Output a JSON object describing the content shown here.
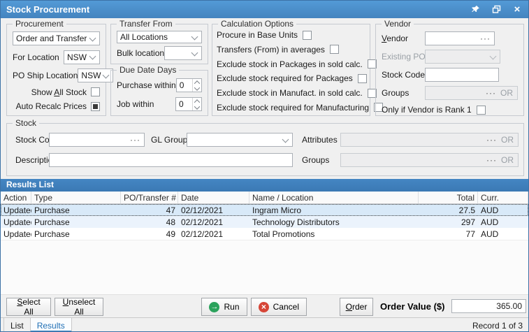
{
  "window": {
    "title": "Stock Procurement"
  },
  "icons": {
    "ellipsis": "···",
    "close": "×",
    "run_arrow": "→",
    "cancel_x": "×"
  },
  "procurement": {
    "legend": "Procurement",
    "mode_value": "Order and Transfer",
    "for_location_label": "For Location",
    "for_location_value": "NSW",
    "po_ship_label": "PO Ship Location",
    "po_ship_value": "NSW",
    "show_all_stock": {
      "pre": "Show ",
      "u": "A",
      "post": "ll Stock"
    },
    "auto_recalc_label": "Auto Recalc Prices"
  },
  "transfer_from": {
    "legend": "Transfer From",
    "value": "All Locations",
    "bulk_label": "Bulk location",
    "bulk_value": ""
  },
  "due_date": {
    "legend": "Due Date Days",
    "purchase_label": "Purchase within",
    "purchase_value": "0",
    "job_label": "Job within",
    "job_value": "0"
  },
  "calc_options": {
    "legend": "Calculation Options",
    "items": [
      "Procure in Base Units",
      "Transfers (From) in averages",
      "Exclude stock in Packages in sold calc.",
      "Exclude stock required for Packages",
      "Exclude stock in Manufact. in sold calc.",
      "Exclude stock required for Manufacturing"
    ]
  },
  "vendor": {
    "legend": "Vendor",
    "vendor_label": {
      "u": "V",
      "post": "endor"
    },
    "existing_po_label": "Existing PO",
    "stock_code_label": "Stock Code",
    "groups_label": "Groups",
    "or_label": "OR",
    "rank_label": "Only if Vendor is Rank 1"
  },
  "stock": {
    "legend": "Stock",
    "stock_code_label": "Stock Code",
    "gl_group_label": "GL Group",
    "attributes_label": "Attributes",
    "description_label": "Description",
    "groups_label": "Groups",
    "or_label": "OR"
  },
  "results": {
    "header": "Results List",
    "columns": [
      "Action",
      "Type",
      "PO/Transfer #",
      "Date",
      "Name / Location",
      "Total",
      "Curr."
    ],
    "rows": [
      {
        "action": "Updated",
        "type": "Purchase",
        "po": "47",
        "date": "02/12/2021",
        "name": "Ingram Micro",
        "total": "27.5",
        "curr": "AUD"
      },
      {
        "action": "Updated",
        "type": "Purchase",
        "po": "48",
        "date": "02/12/2021",
        "name": "Technology Distributors",
        "total": "297",
        "curr": "AUD"
      },
      {
        "action": "Updated",
        "type": "Purchase",
        "po": "49",
        "date": "02/12/2021",
        "name": "Total Promotions",
        "total": "77",
        "curr": "AUD"
      }
    ]
  },
  "footer": {
    "select_all": {
      "u": "S",
      "post": "elect All"
    },
    "unselect_all": {
      "u": "U",
      "post": "nselect All"
    },
    "run": "Run",
    "cancel": "Cancel",
    "order": {
      "u": "O",
      "post": "rder"
    },
    "order_value_label": "Order Value ($)",
    "order_value": "365.00"
  },
  "tabs": {
    "list": "List",
    "results": "Results"
  },
  "status": "Record 1 of 3"
}
